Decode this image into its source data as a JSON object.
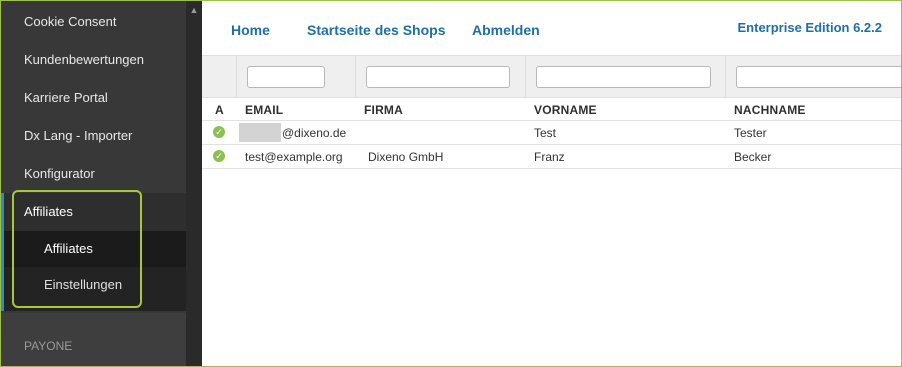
{
  "sidebar": {
    "items": [
      {
        "label": "Cookie Consent"
      },
      {
        "label": "Kundenbewertungen"
      },
      {
        "label": "Karriere Portal"
      },
      {
        "label": "Dx Lang - Importer"
      },
      {
        "label": "Konfigurator"
      },
      {
        "label": "Affiliates"
      }
    ],
    "subitems": [
      {
        "label": "Affiliates"
      },
      {
        "label": "Einstellungen"
      }
    ],
    "section_label": "PAYONE"
  },
  "header": {
    "nav": [
      {
        "label": "Home"
      },
      {
        "label": "Startseite des Shops"
      },
      {
        "label": "Abmelden"
      }
    ],
    "edition": "Enterprise Edition 6.2.2"
  },
  "table": {
    "columns": [
      "A",
      "EMAIL",
      "FIRMA",
      "VORNAME",
      "NACHNAME"
    ],
    "rows": [
      {
        "status": "active",
        "email": "@dixeno.de",
        "firma": "",
        "vorname": "Test",
        "nachname": "Tester"
      },
      {
        "status": "active",
        "email": "test@example.org",
        "firma": "Dixeno GmbH",
        "vorname": "Franz",
        "nachname": "Becker"
      }
    ]
  },
  "colors": {
    "sidebar_bg": "#383838",
    "link": "#1f6fa5",
    "active_status": "#8cc152",
    "highlight": "#a8c83a"
  }
}
